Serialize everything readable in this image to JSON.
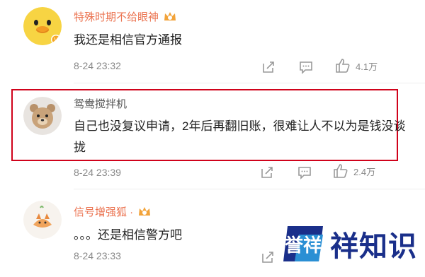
{
  "comments": [
    {
      "username": "特殊时期不给眼神",
      "text": "我还是相信官方通报",
      "timestamp": "8-24 23:32",
      "like_count": "4.1万"
    },
    {
      "username": "鸳鸯搅拌机",
      "text": "自己也没复议申请，2年后再翻旧账，很难让人不以为是钱没谈拢",
      "timestamp": "8-24 23:39",
      "like_count": "2.4万"
    },
    {
      "username": "信号增强狐 ·",
      "text": "。。。还是相信警方吧",
      "timestamp": "8-24 23:33"
    }
  ],
  "watermark": {
    "logo_text": "誉祥",
    "chars": [
      "祥",
      "知",
      "识"
    ]
  },
  "colors": {
    "username": "#eb7350",
    "highlight_border": "#d0021b",
    "watermark": "#1a2f8a"
  },
  "icons": [
    "yellow-duck-avatar",
    "bear-avatar",
    "fox-avatar",
    "vip-badge-icon",
    "share-icon",
    "reply-icon",
    "thumbs-up-icon"
  ]
}
